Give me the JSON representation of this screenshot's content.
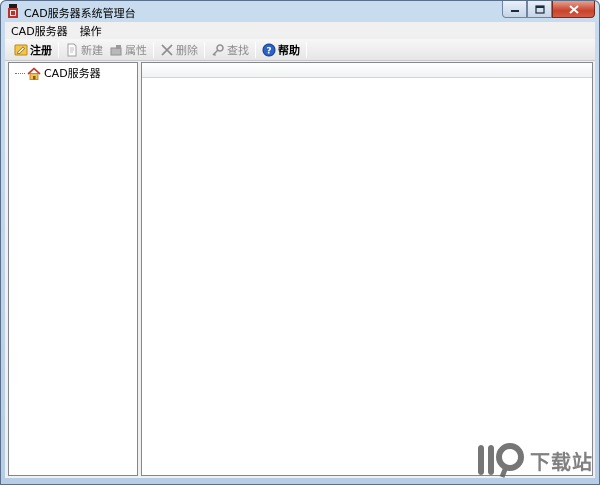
{
  "window": {
    "title": "CAD服务器系统管理台",
    "icon": "cad-app-icon"
  },
  "menubar": {
    "items": [
      {
        "label": "CAD服务器"
      },
      {
        "label": "操作"
      }
    ]
  },
  "toolbar": {
    "register": {
      "label": "注册",
      "icon": "register-icon",
      "enabled": true
    },
    "new": {
      "label": "新建",
      "icon": "new-doc-icon",
      "enabled": false
    },
    "properties": {
      "label": "属性",
      "icon": "properties-icon",
      "enabled": false
    },
    "delete": {
      "label": "删除",
      "icon": "delete-x-icon",
      "enabled": false
    },
    "find": {
      "label": "查找",
      "icon": "find-key-icon",
      "enabled": false
    },
    "help": {
      "label": "帮助",
      "icon": "help-icon",
      "enabled": true
    }
  },
  "tree": {
    "root": {
      "label": "CAD服务器",
      "icon": "home-icon"
    }
  },
  "list": {
    "columns": []
  },
  "watermark": {
    "text": "下载站"
  },
  "colors": {
    "titlebar": "#c9dcef",
    "close_button": "#c7432c",
    "client_bg": "#f0f0f0"
  }
}
